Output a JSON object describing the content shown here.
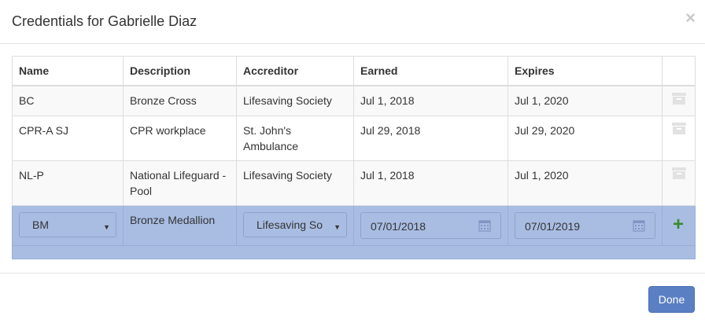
{
  "modal": {
    "title": "Credentials for Gabrielle Diaz",
    "close_symbol": "×"
  },
  "table": {
    "headers": [
      "Name",
      "Description",
      "Accreditor",
      "Earned",
      "Expires"
    ],
    "rows": [
      {
        "name": "BC",
        "description": "Bronze Cross",
        "accreditor": "Lifesaving Society",
        "earned": "Jul 1, 2018",
        "expires": "Jul 1, 2020"
      },
      {
        "name": "CPR-A SJ",
        "description": "CPR workplace",
        "accreditor": "St. John's Ambulance",
        "earned": "Jul 29, 2018",
        "expires": "Jul 29, 2020"
      },
      {
        "name": "NL-P",
        "description": "National Lifeguard - Pool",
        "accreditor": "Lifesaving Society",
        "earned": "Jul 1, 2018",
        "expires": "Jul 1, 2020"
      }
    ],
    "new_row": {
      "name_select": "BM",
      "description": "Bronze Medallion",
      "accreditor_select": "Lifesaving So",
      "earned_input": "07/01/2018",
      "expires_input": "07/01/2019",
      "add_symbol": "+"
    }
  },
  "footer": {
    "done_label": "Done"
  },
  "icons": {
    "row_action": "archive-icon",
    "date_picker": "calendar-icon",
    "add": "plus-icon",
    "close": "close-icon"
  },
  "colors": {
    "edit_row_bg": "#a9bde3",
    "primary_button": "#5b7fc3",
    "add_green": "#3a8a2e"
  }
}
